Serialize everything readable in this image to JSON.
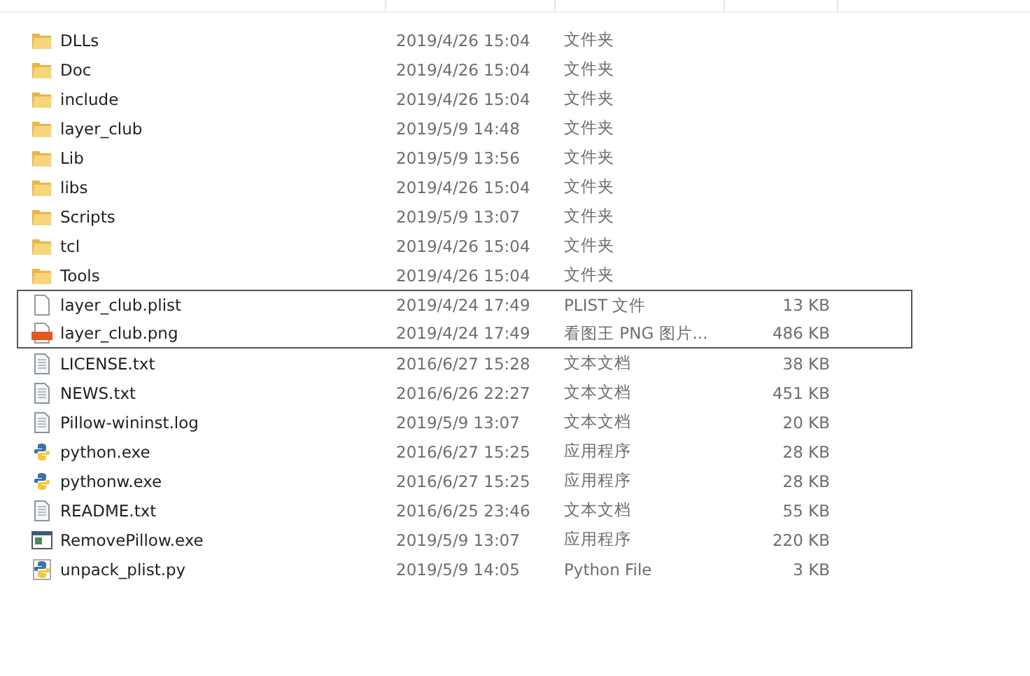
{
  "files": [
    {
      "name": "DLLs",
      "date": "2019/4/26 15:04",
      "type": "文件夹",
      "kind": "folder",
      "highlighted": false
    },
    {
      "name": "Doc",
      "date": "2019/4/26 15:04",
      "type": "文件夹",
      "kind": "folder",
      "highlighted": false
    },
    {
      "name": "include",
      "date": "2019/4/26 15:04",
      "type": "文件夹",
      "kind": "folder",
      "highlighted": false
    },
    {
      "name": "layer_club",
      "date": "2019/5/9 14:48",
      "type": "文件夹",
      "kind": "folder",
      "highlighted": false
    },
    {
      "name": "Lib",
      "date": "2019/5/9 13:56",
      "type": "文件夹",
      "kind": "folder",
      "highlighted": false
    },
    {
      "name": "libs",
      "date": "2019/4/26 15:04",
      "type": "文件夹",
      "kind": "folder",
      "highlighted": false
    },
    {
      "name": "Scripts",
      "date": "2019/5/9 13:07",
      "type": "文件夹",
      "kind": "folder",
      "highlighted": false
    },
    {
      "name": "tcl",
      "date": "2019/4/26 15:04",
      "type": "文件夹",
      "kind": "folder",
      "highlighted": false
    },
    {
      "name": "Tools",
      "date": "2019/4/26 15:04",
      "type": "文件夹",
      "kind": "folder",
      "highlighted": false
    },
    {
      "name": "layer_club.plist",
      "date": "2019/4/24 17:49",
      "type": "PLIST 文件",
      "size": "13 KB",
      "kind": "file",
      "highlighted": true
    },
    {
      "name": "layer_club.png",
      "date": "2019/4/24 17:49",
      "type": "看图王 PNG 图片...",
      "size": "486 KB",
      "kind": "png",
      "highlighted": true
    },
    {
      "name": "LICENSE.txt",
      "date": "2016/6/27 15:28",
      "type": "文本文档",
      "size": "38 KB",
      "kind": "text",
      "highlighted": false
    },
    {
      "name": "NEWS.txt",
      "date": "2016/6/26 22:27",
      "type": "文本文档",
      "size": "451 KB",
      "kind": "text",
      "highlighted": false
    },
    {
      "name": "Pillow-wininst.log",
      "date": "2019/5/9 13:07",
      "type": "文本文档",
      "size": "20 KB",
      "kind": "text",
      "highlighted": false
    },
    {
      "name": "python.exe",
      "date": "2016/6/27 15:25",
      "type": "应用程序",
      "size": "28 KB",
      "kind": "python",
      "highlighted": false
    },
    {
      "name": "pythonw.exe",
      "date": "2016/6/27 15:25",
      "type": "应用程序",
      "size": "28 KB",
      "kind": "python",
      "highlighted": false
    },
    {
      "name": "README.txt",
      "date": "2016/6/25 23:46",
      "type": "文本文档",
      "size": "55 KB",
      "kind": "text",
      "highlighted": false
    },
    {
      "name": "RemovePillow.exe",
      "date": "2019/5/9 13:07",
      "type": "应用程序",
      "size": "220 KB",
      "kind": "exe",
      "highlighted": false
    },
    {
      "name": "unpack_plist.py",
      "date": "2019/5/9 14:05",
      "type": "Python File",
      "size": "3 KB",
      "kind": "pyfile",
      "highlighted": false
    }
  ]
}
